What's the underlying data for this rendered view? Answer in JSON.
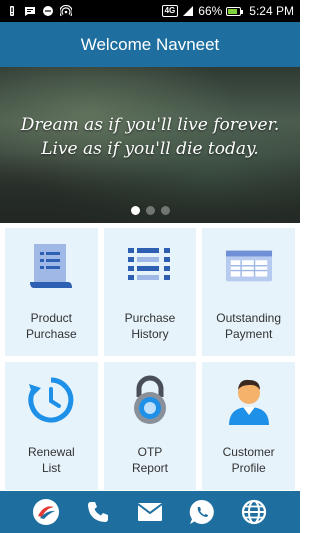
{
  "status_bar": {
    "network_badge": "4G",
    "battery": "66%",
    "time": "5:24 PM",
    "icons": [
      "notification-alert-icon",
      "message-icon",
      "chat-icon",
      "hotspot-icon",
      "signal-icon",
      "battery-charging-icon"
    ]
  },
  "header": {
    "title": "Welcome Navneet"
  },
  "banner": {
    "quote_line1": "Dream as if you'll live forever.",
    "quote_line2": "Live as if you'll die today.",
    "slide_count": 3,
    "active_slide": 1
  },
  "tiles": [
    {
      "line1": "Product",
      "line2": "Purchase",
      "icon": "document-list-icon"
    },
    {
      "line1": "Purchase",
      "line2": "History",
      "icon": "list-lines-icon"
    },
    {
      "line1": "Outstanding",
      "line2": "Payment",
      "icon": "table-window-icon"
    },
    {
      "line1": "Renewal",
      "line2": "List",
      "icon": "clock-refresh-icon"
    },
    {
      "line1": "OTP",
      "line2": "Report",
      "icon": "padlock-icon"
    },
    {
      "line1": "Customer",
      "line2": "Profile",
      "icon": "person-avatar-icon"
    }
  ],
  "bottom_bar": {
    "icons": [
      "brand-logo-icon",
      "phone-icon",
      "mail-icon",
      "whatsapp-icon",
      "globe-icon"
    ]
  },
  "colors": {
    "primary": "#1e6f9f",
    "tile_bg": "#e6f3fb",
    "icon_blue": "#2d5fb2",
    "accent_orange": "#ff9800"
  }
}
